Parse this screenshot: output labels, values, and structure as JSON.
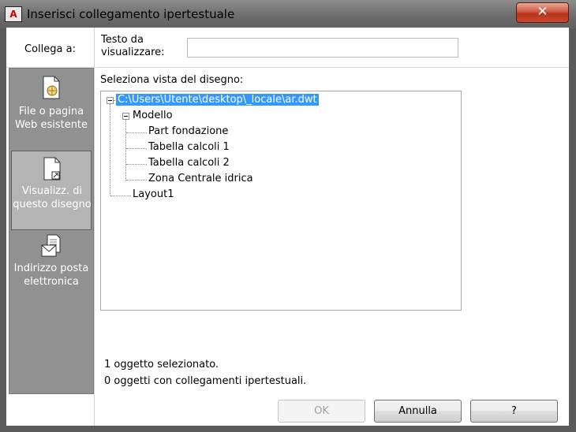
{
  "window": {
    "title": "Inserisci collegamento ipertestuale",
    "app_icon": "A",
    "close_glyph": "✕"
  },
  "sidebar": {
    "header": "Collega a:",
    "items": [
      {
        "label_line1": "File o pagina",
        "label_line2": "Web esistente",
        "icon": "web-page-icon",
        "selected": false
      },
      {
        "label_line1": "Visualizz. di",
        "label_line2": "questo disegno",
        "icon": "drawing-view-icon",
        "selected": true
      },
      {
        "label_line1": "Indirizzo posta",
        "label_line2": "elettronica",
        "icon": "email-icon",
        "selected": false
      }
    ]
  },
  "main": {
    "text_label_line1": "Testo da",
    "text_label_line2": "visualizzare:",
    "text_value": "",
    "view_label": "Seleziona vista del disegno:",
    "tree": {
      "root": "C:\\Users\\Utente\\desktop\\_locale\\ar.dwt",
      "modello": "Modello",
      "children": [
        "Part fondazione",
        "Tabella calcoli 1",
        "Tabella calcoli 2",
        "Zona Centrale idrica"
      ],
      "layout": "Layout1"
    },
    "status_selected": "1 oggetto selezionato.",
    "status_links": "0 oggetti con collegamenti ipertestuali."
  },
  "buttons": {
    "ok": "OK",
    "cancel": "Annulla",
    "help": "?"
  }
}
